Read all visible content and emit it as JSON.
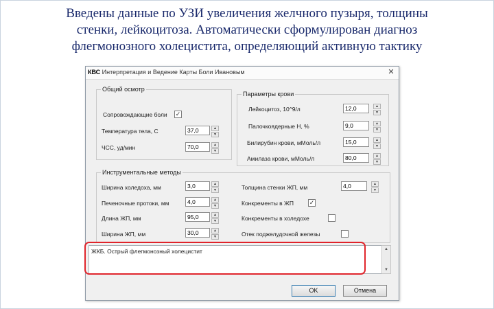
{
  "slide": {
    "title_lines": [
      "Введены данные по УЗИ увеличения желчного пузыря, толщины",
      "стенки, лейкоцитоза. Автоматически сформулирован диагноз",
      "флегмонозного холецистита, определяющий активную тактику"
    ]
  },
  "window": {
    "app": "КВС",
    "title": " Интерпретация и Ведение Карты Боли Ивановым",
    "close": "✕"
  },
  "general": {
    "legend": "Общий осмотр",
    "pain_label": "Сопровождающие боли",
    "pain_checked": "✓",
    "temp_label": "Температура тела, С",
    "temp_value": "37,0",
    "hr_label": "ЧСС, уд/мин",
    "hr_value": "70,0"
  },
  "blood": {
    "legend": "Параметры крови",
    "leuko_label": "Лейкоцитоз, 10^9/л",
    "leuko_value": "12,0",
    "band_label": "Палочкоядерные Н, %",
    "band_value": "9,0",
    "bili_label": "Билирубин крови, мМоль/л",
    "bili_value": "15,0",
    "amyl_label": "Амилаза крови, мМоль/л",
    "amyl_value": "80,0"
  },
  "instrumental": {
    "legend": "Инструментальные методы",
    "chol_width_label": "Ширина холедоха, мм",
    "chol_width_value": "3,0",
    "ducts_label": "Печеночные протоки, мм",
    "ducts_value": "4,0",
    "gb_length_label": "Длина ЖП, мм",
    "gb_length_value": "95,0",
    "gb_width_label": "Ширина ЖП, мм",
    "gb_width_value": "30,0",
    "wall_label": "Толщина стенки ЖП, мм",
    "wall_value": "4,0",
    "stones_gb_label": "Конкременты в ЖП",
    "stones_gb_checked": "✓",
    "stones_chol_label": "Конкременты в холедохе",
    "stones_chol_checked": "",
    "pancreas_label": "Отек поджелудочной железы",
    "pancreas_checked": ""
  },
  "diagnosis": {
    "text": "ЖКБ. Острый флегмонозный холецистит"
  },
  "buttons": {
    "ok": "OK",
    "cancel": "Отмена"
  },
  "spin_up": "▲",
  "spin_down": "▼",
  "colors": {
    "title": "#1a2a6c",
    "highlight": "#e0242b",
    "dialog_bg": "#f0f0f0"
  }
}
